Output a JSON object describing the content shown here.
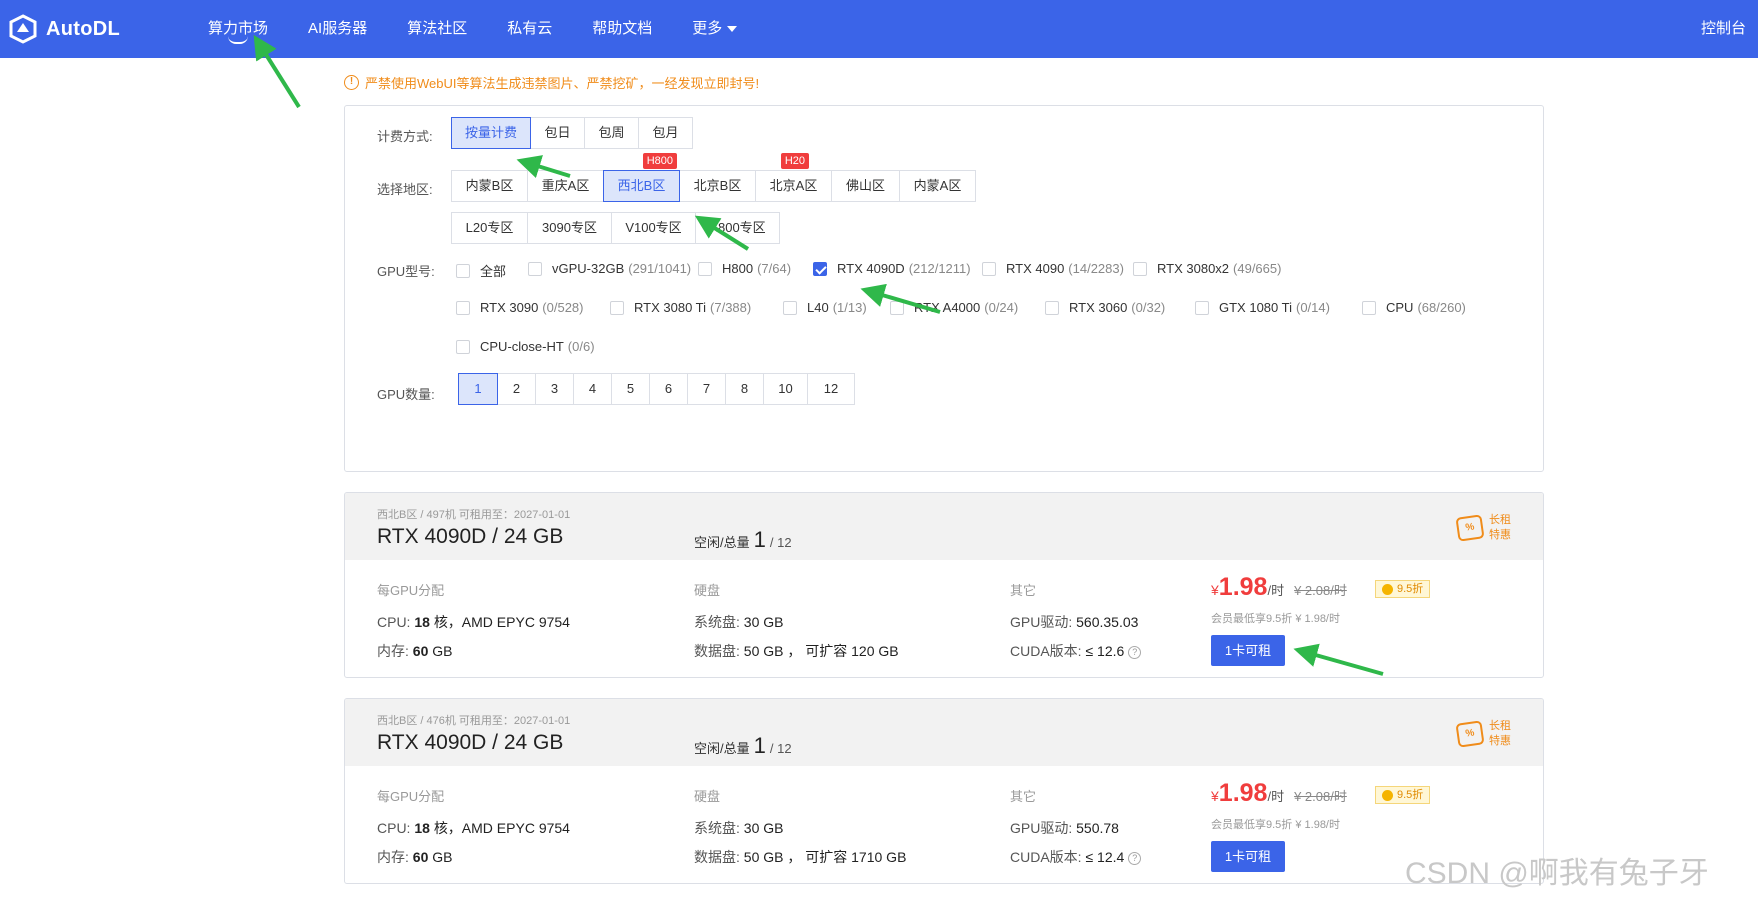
{
  "header": {
    "logo_text": "AutoDL",
    "nav": [
      "算力市场",
      "AI服务器",
      "算法社区",
      "私有云",
      "帮助文档",
      "更多"
    ],
    "console_label": "控制台"
  },
  "warning": "严禁使用WebUI等算法生成违禁图片、严禁挖矿，一经发现立即封号!",
  "filter": {
    "billing_label": "计费方式:",
    "billing": [
      "按量计费",
      "包日",
      "包周",
      "包月"
    ],
    "region_label": "选择地区:",
    "regions_row1": [
      "内蒙B区",
      "重庆A区",
      "西北B区",
      "北京B区",
      "北京A区",
      "佛山区",
      "内蒙A区"
    ],
    "region_badges": {
      "xibei_b": "H800",
      "beijing_a": "H20"
    },
    "regions_row2": [
      "L20专区",
      "3090专区",
      "V100专区",
      "A800专区"
    ],
    "gpu_label": "GPU型号:",
    "gpus": [
      {
        "name": "全部",
        "count": ""
      },
      {
        "name": "vGPU-32GB",
        "count": "(291/1041)"
      },
      {
        "name": "H800",
        "count": "(7/64)"
      },
      {
        "name": "RTX 4090D",
        "count": "(212/1211)"
      },
      {
        "name": "RTX 4090",
        "count": "(14/2283)"
      },
      {
        "name": "RTX 3080x2",
        "count": "(49/665)"
      },
      {
        "name": "RTX 3090",
        "count": "(0/528)"
      },
      {
        "name": "RTX 3080 Ti",
        "count": "(7/388)"
      },
      {
        "name": "L40",
        "count": "(1/13)"
      },
      {
        "name": "RTX A4000",
        "count": "(0/24)"
      },
      {
        "name": "RTX 3060",
        "count": "(0/32)"
      },
      {
        "name": "GTX 1080 Ti",
        "count": "(0/14)"
      },
      {
        "name": "CPU",
        "count": "(68/260)"
      },
      {
        "name": "CPU-close-HT",
        "count": "(0/6)"
      }
    ],
    "gpu_count_label": "GPU数量:",
    "gpu_counts": [
      "1",
      "2",
      "3",
      "4",
      "5",
      "6",
      "7",
      "8",
      "10",
      "12"
    ]
  },
  "cards": [
    {
      "meta": "西北B区 / 497机   可租用至：2027-01-01",
      "model": "RTX 4090D / 24 GB",
      "avail_label": "空闲/总量",
      "avail_free": "1",
      "avail_total": "/ 12",
      "promo": "长租特惠",
      "h_gpu": "每GPU分配",
      "h_disk": "硬盘",
      "h_other": "其它",
      "cpu_label": "CPU:",
      "cpu_cores": "18",
      "cpu_rest": "核，AMD EPYC 9754",
      "mem_label": "内存:",
      "mem_val": "60",
      "mem_unit": "GB",
      "sys_label": "系统盘:",
      "sys_val": "30 GB",
      "data_label": "数据盘:",
      "data_val": "50 GB ， 可扩容 120 GB",
      "drv_label": "GPU驱动:",
      "drv_val": "560.35.03",
      "cuda_label": "CUDA版本:",
      "cuda_val": "≤ 12.6",
      "cur": "¥",
      "price": "1.98",
      "unit": "/时",
      "old_price": "¥ 2.08/时",
      "discount": "9.5折",
      "member": "会员最低享9.5折 ¥ 1.98/时",
      "rent": "1卡可租"
    },
    {
      "meta": "西北B区 / 476机   可租用至：2027-01-01",
      "model": "RTX 4090D / 24 GB",
      "avail_label": "空闲/总量",
      "avail_free": "1",
      "avail_total": "/ 12",
      "promo": "长租特惠",
      "h_gpu": "每GPU分配",
      "h_disk": "硬盘",
      "h_other": "其它",
      "cpu_label": "CPU:",
      "cpu_cores": "18",
      "cpu_rest": "核，AMD EPYC 9754",
      "mem_label": "内存:",
      "mem_val": "60",
      "mem_unit": "GB",
      "sys_label": "系统盘:",
      "sys_val": "30 GB",
      "data_label": "数据盘:",
      "data_val": "50 GB ， 可扩容 1710 GB",
      "drv_label": "GPU驱动:",
      "drv_val": "550.78",
      "cuda_label": "CUDA版本:",
      "cuda_val": "≤ 12.4",
      "cur": "¥",
      "price": "1.98",
      "unit": "/时",
      "old_price": "¥ 2.08/时",
      "discount": "9.5折",
      "member": "会员最低享9.5折 ¥ 1.98/时",
      "rent": "1卡可租"
    }
  ],
  "watermark": "CSDN @啊我有兔子牙",
  "colors": {
    "primary": "#3b64e8",
    "warning": "#f08c1a",
    "price": "#f03d3d",
    "annotation_arrow": "#2fb84a"
  }
}
